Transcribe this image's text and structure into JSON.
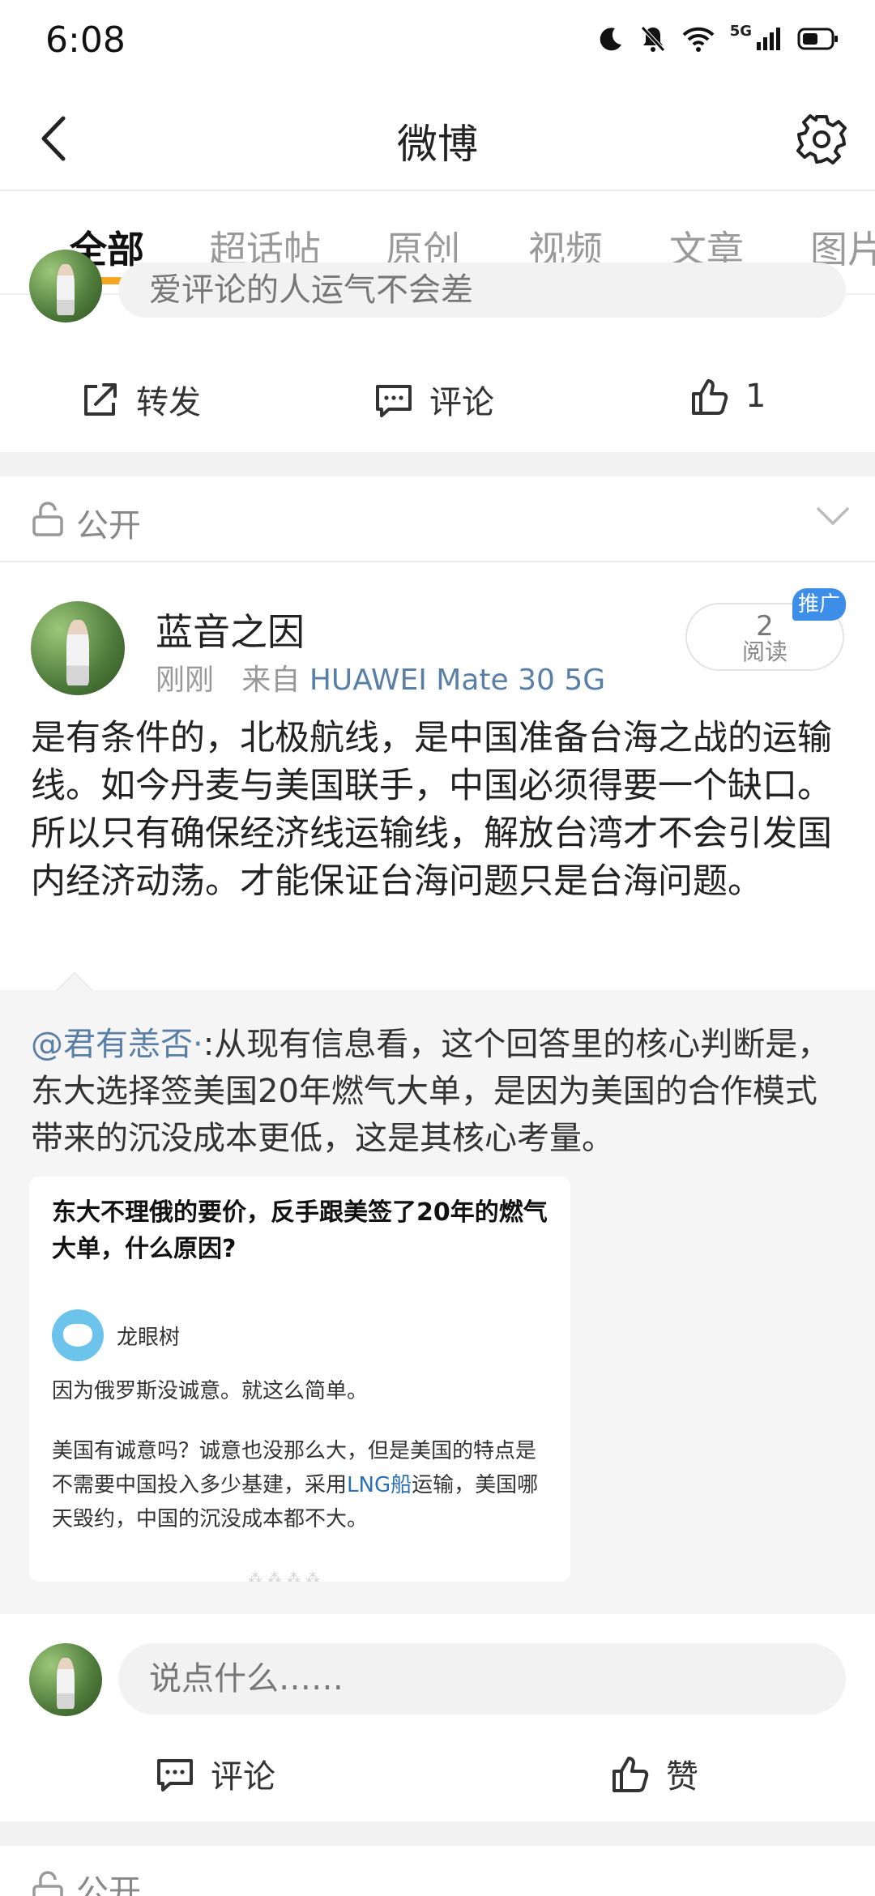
{
  "status_bar": {
    "time": "6:08",
    "network": "5G"
  },
  "nav": {
    "title": "微博"
  },
  "tabs": [
    {
      "label": "全部",
      "active": true
    },
    {
      "label": "超话帖",
      "active": false
    },
    {
      "label": "原创",
      "active": false
    },
    {
      "label": "视频",
      "active": false
    },
    {
      "label": "文章",
      "active": false
    },
    {
      "label": "图片",
      "active": false
    }
  ],
  "prev_card": {
    "comment_placeholder": "爱评论的人运气不会差",
    "actions": {
      "repost": "转发",
      "comment": "评论",
      "like_count": "1"
    }
  },
  "visibility": {
    "label": "公开"
  },
  "post": {
    "author": "蓝音之因",
    "time": "刚刚",
    "source_prefix": "来自",
    "device": "HUAWEI Mate 30 5G",
    "read_count": "2",
    "read_label": "阅读",
    "promo_label": "推广",
    "text": "是有条件的，北极航线，是中国准备台海之战的运输线。如今丹麦与美国联手，中国必须得要一个缺口。所以只有确保经济线运输线，解放台湾才不会引发国内经济动荡。才能保证台海问题只是台海问题。"
  },
  "repost": {
    "mention": "@君有恙否·",
    "text": ":从现有信息看，这个回答里的核心判断是，东大选择签美国20年燃气大单，是因为美国的合作模式带来的沉没成本更低，这是其核心考量。",
    "quote": {
      "title": "东大不理俄的要价，反手跟美签了20年的燃气大单，什么原因?",
      "author": "龙眼树",
      "line1": "因为俄罗斯没诚意。就这么简单。",
      "line2_a": "美国有诚意吗？诚意也没那么大，但是美国的特点是不需要中国投入多少基建，采用",
      "line2_link": "LNG船",
      "line2_b": "运输，美国哪天毁约，中国的沉没成本都不大。"
    }
  },
  "bottom": {
    "comment_placeholder": "说点什么……",
    "comment_label": "评论",
    "like_label": "赞"
  },
  "next_post": {
    "visibility": "公开"
  },
  "colors": {
    "accent": "#f5a623",
    "link": "#5a7fa6",
    "promo": "#3d8ee8"
  }
}
